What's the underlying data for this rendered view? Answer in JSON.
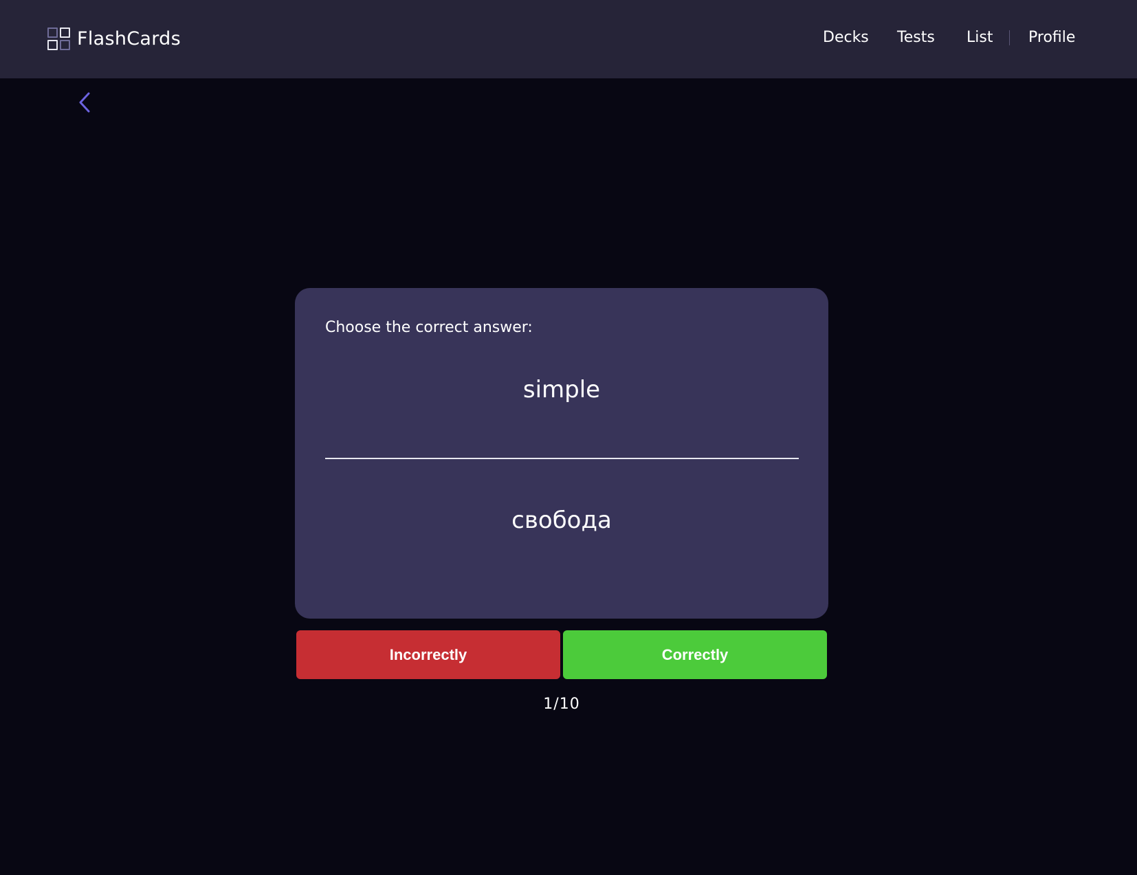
{
  "app": {
    "name": "FlashCards"
  },
  "nav": {
    "decks": "Decks",
    "tests": "Tests",
    "list": "List",
    "profile": "Profile"
  },
  "icons": {
    "logo": "grid-icon",
    "back": "chevron-left-icon"
  },
  "card": {
    "prompt": "Choose the correct answer:",
    "term": "simple",
    "answer": "свобода"
  },
  "actions": {
    "incorrect_label": "Incorrectly",
    "correct_label": "Correctly"
  },
  "progress": {
    "text": "1/10",
    "current": 1,
    "total": 10
  },
  "colors": {
    "background": "#080713",
    "header": "#262438",
    "card": "#383459",
    "accent": "#6c63e0",
    "incorrect": "#c62e33",
    "correct": "#4ccb3b"
  }
}
